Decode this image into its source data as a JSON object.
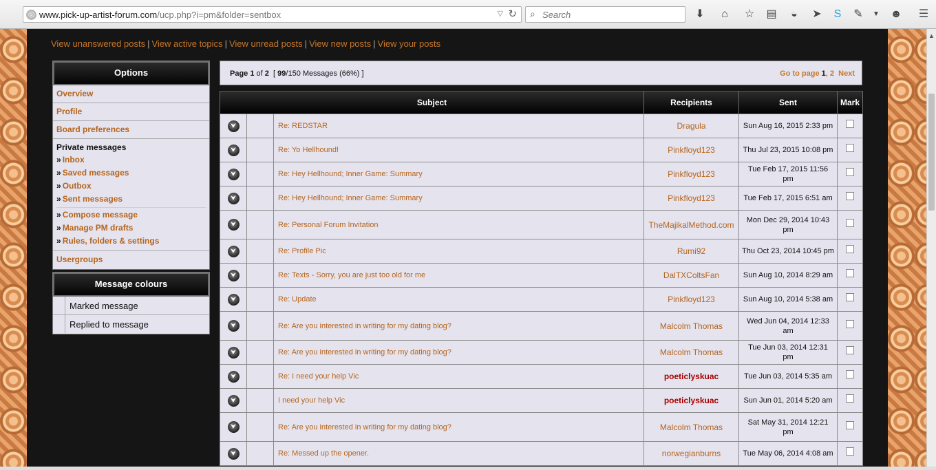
{
  "browser": {
    "url_host": "www.pick-up-artist-forum.com",
    "url_path": "/ucp.php?i=pm&folder=sentbox",
    "search_placeholder": "Search"
  },
  "quick_links": [
    "View unanswered posts",
    "View active topics",
    "View unread posts",
    "View new posts",
    "View your posts"
  ],
  "options": {
    "title": "Options",
    "overview": "Overview",
    "profile": "Profile",
    "board_preferences": "Board preferences",
    "pm_title": "Private messages",
    "pm_links": [
      "Inbox",
      "Saved messages",
      "Outbox",
      "Sent messages"
    ],
    "pm_tools": [
      "Compose message",
      "Manage PM drafts",
      "Rules, folders & settings"
    ],
    "usergroups": "Usergroups"
  },
  "message_colours": {
    "title": "Message colours",
    "items": [
      "Marked message",
      "Replied to message"
    ]
  },
  "pagination": {
    "page_label": "Page",
    "current": "1",
    "of_label": "of",
    "total": "2",
    "count_prefix": "[",
    "count_used": "99",
    "count_rest": "/150 Messages (66%) ]",
    "goto_label": "Go to page",
    "page1": "1",
    "page2": "2",
    "next": "Next"
  },
  "table": {
    "headers": {
      "subject": "Subject",
      "recipients": "Recipients",
      "sent": "Sent",
      "mark": "Mark"
    },
    "rows": [
      {
        "subject": "Re: REDSTAR",
        "recipient": "Dragula",
        "sent": "Sun Aug 16, 2015 2:33 pm"
      },
      {
        "subject": "Re: Yo Hellhound!",
        "recipient": "Pinkfloyd123",
        "sent": "Thu Jul 23, 2015 10:08 pm"
      },
      {
        "subject": "Re: Hey Hellhound; Inner Game: Summary",
        "recipient": "Pinkfloyd123",
        "sent": "Tue Feb 17, 2015 11:56 pm"
      },
      {
        "subject": "Re: Hey Hellhound; Inner Game: Summary",
        "recipient": "Pinkfloyd123",
        "sent": "Tue Feb 17, 2015 6:51 am"
      },
      {
        "subject": "Re: Personal Forum Invitation",
        "recipient": "TheMajikalMethod.com",
        "sent": "Mon Dec 29, 2014 10:43 pm"
      },
      {
        "subject": "Re: Profile Pic",
        "recipient": "Rumi92",
        "sent": "Thu Oct 23, 2014 10:45 pm"
      },
      {
        "subject": "Re: Texts - Sorry, you are just too old for me",
        "recipient": "DalTXColtsFan",
        "sent": "Sun Aug 10, 2014 8:29 am"
      },
      {
        "subject": "Re: Update",
        "recipient": "Pinkfloyd123",
        "sent": "Sun Aug 10, 2014 5:38 am"
      },
      {
        "subject": "Re: Are you interested in writing for my dating blog?",
        "recipient": "Malcolm Thomas",
        "sent": "Wed Jun 04, 2014 12:33 am"
      },
      {
        "subject": "Re: Are you interested in writing for my dating blog?",
        "recipient": "Malcolm Thomas",
        "sent": "Tue Jun 03, 2014 12:31 pm"
      },
      {
        "subject": "Re: I need your help Vic",
        "recipient": "poeticlyskuac",
        "sent": "Tue Jun 03, 2014 5:35 am"
      },
      {
        "subject": "I need your help Vic",
        "recipient": "poeticlyskuac",
        "sent": "Sun Jun 01, 2014 5:20 am"
      },
      {
        "subject": "Re: Are you interested in writing for my dating blog?",
        "recipient": "Malcolm Thomas",
        "sent": "Sat May 31, 2014 12:21 pm"
      },
      {
        "subject": "Re: Messed up the opener.",
        "recipient": "norwegianburns",
        "sent": "Tue May 06, 2014 4:08 am"
      }
    ]
  }
}
